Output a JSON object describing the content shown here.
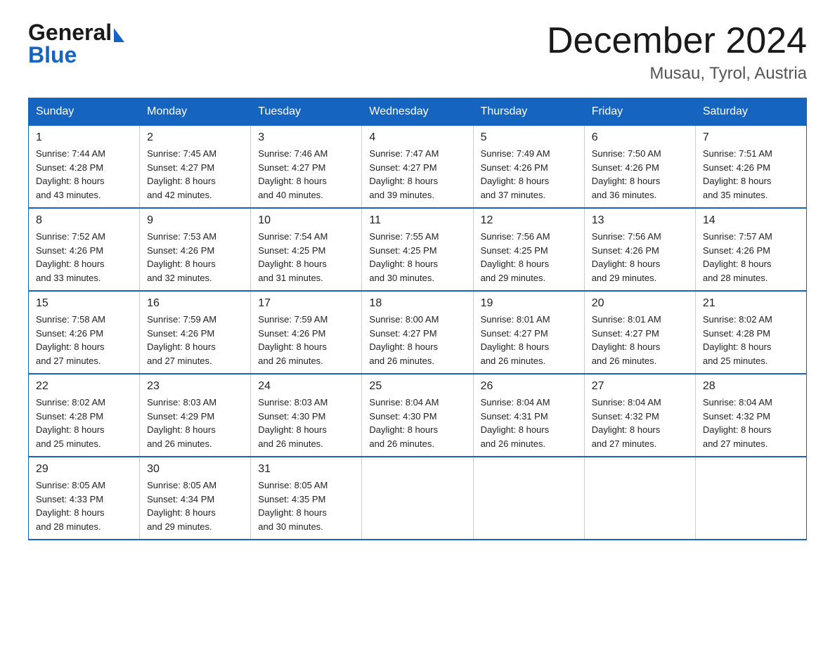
{
  "header": {
    "logo_general": "General",
    "logo_blue": "Blue",
    "month": "December 2024",
    "location": "Musau, Tyrol, Austria"
  },
  "weekdays": [
    "Sunday",
    "Monday",
    "Tuesday",
    "Wednesday",
    "Thursday",
    "Friday",
    "Saturday"
  ],
  "weeks": [
    [
      {
        "day": "1",
        "info": "Sunrise: 7:44 AM\nSunset: 4:28 PM\nDaylight: 8 hours\nand 43 minutes."
      },
      {
        "day": "2",
        "info": "Sunrise: 7:45 AM\nSunset: 4:27 PM\nDaylight: 8 hours\nand 42 minutes."
      },
      {
        "day": "3",
        "info": "Sunrise: 7:46 AM\nSunset: 4:27 PM\nDaylight: 8 hours\nand 40 minutes."
      },
      {
        "day": "4",
        "info": "Sunrise: 7:47 AM\nSunset: 4:27 PM\nDaylight: 8 hours\nand 39 minutes."
      },
      {
        "day": "5",
        "info": "Sunrise: 7:49 AM\nSunset: 4:26 PM\nDaylight: 8 hours\nand 37 minutes."
      },
      {
        "day": "6",
        "info": "Sunrise: 7:50 AM\nSunset: 4:26 PM\nDaylight: 8 hours\nand 36 minutes."
      },
      {
        "day": "7",
        "info": "Sunrise: 7:51 AM\nSunset: 4:26 PM\nDaylight: 8 hours\nand 35 minutes."
      }
    ],
    [
      {
        "day": "8",
        "info": "Sunrise: 7:52 AM\nSunset: 4:26 PM\nDaylight: 8 hours\nand 33 minutes."
      },
      {
        "day": "9",
        "info": "Sunrise: 7:53 AM\nSunset: 4:26 PM\nDaylight: 8 hours\nand 32 minutes."
      },
      {
        "day": "10",
        "info": "Sunrise: 7:54 AM\nSunset: 4:25 PM\nDaylight: 8 hours\nand 31 minutes."
      },
      {
        "day": "11",
        "info": "Sunrise: 7:55 AM\nSunset: 4:25 PM\nDaylight: 8 hours\nand 30 minutes."
      },
      {
        "day": "12",
        "info": "Sunrise: 7:56 AM\nSunset: 4:25 PM\nDaylight: 8 hours\nand 29 minutes."
      },
      {
        "day": "13",
        "info": "Sunrise: 7:56 AM\nSunset: 4:26 PM\nDaylight: 8 hours\nand 29 minutes."
      },
      {
        "day": "14",
        "info": "Sunrise: 7:57 AM\nSunset: 4:26 PM\nDaylight: 8 hours\nand 28 minutes."
      }
    ],
    [
      {
        "day": "15",
        "info": "Sunrise: 7:58 AM\nSunset: 4:26 PM\nDaylight: 8 hours\nand 27 minutes."
      },
      {
        "day": "16",
        "info": "Sunrise: 7:59 AM\nSunset: 4:26 PM\nDaylight: 8 hours\nand 27 minutes."
      },
      {
        "day": "17",
        "info": "Sunrise: 7:59 AM\nSunset: 4:26 PM\nDaylight: 8 hours\nand 26 minutes."
      },
      {
        "day": "18",
        "info": "Sunrise: 8:00 AM\nSunset: 4:27 PM\nDaylight: 8 hours\nand 26 minutes."
      },
      {
        "day": "19",
        "info": "Sunrise: 8:01 AM\nSunset: 4:27 PM\nDaylight: 8 hours\nand 26 minutes."
      },
      {
        "day": "20",
        "info": "Sunrise: 8:01 AM\nSunset: 4:27 PM\nDaylight: 8 hours\nand 26 minutes."
      },
      {
        "day": "21",
        "info": "Sunrise: 8:02 AM\nSunset: 4:28 PM\nDaylight: 8 hours\nand 25 minutes."
      }
    ],
    [
      {
        "day": "22",
        "info": "Sunrise: 8:02 AM\nSunset: 4:28 PM\nDaylight: 8 hours\nand 25 minutes."
      },
      {
        "day": "23",
        "info": "Sunrise: 8:03 AM\nSunset: 4:29 PM\nDaylight: 8 hours\nand 26 minutes."
      },
      {
        "day": "24",
        "info": "Sunrise: 8:03 AM\nSunset: 4:30 PM\nDaylight: 8 hours\nand 26 minutes."
      },
      {
        "day": "25",
        "info": "Sunrise: 8:04 AM\nSunset: 4:30 PM\nDaylight: 8 hours\nand 26 minutes."
      },
      {
        "day": "26",
        "info": "Sunrise: 8:04 AM\nSunset: 4:31 PM\nDaylight: 8 hours\nand 26 minutes."
      },
      {
        "day": "27",
        "info": "Sunrise: 8:04 AM\nSunset: 4:32 PM\nDaylight: 8 hours\nand 27 minutes."
      },
      {
        "day": "28",
        "info": "Sunrise: 8:04 AM\nSunset: 4:32 PM\nDaylight: 8 hours\nand 27 minutes."
      }
    ],
    [
      {
        "day": "29",
        "info": "Sunrise: 8:05 AM\nSunset: 4:33 PM\nDaylight: 8 hours\nand 28 minutes."
      },
      {
        "day": "30",
        "info": "Sunrise: 8:05 AM\nSunset: 4:34 PM\nDaylight: 8 hours\nand 29 minutes."
      },
      {
        "day": "31",
        "info": "Sunrise: 8:05 AM\nSunset: 4:35 PM\nDaylight: 8 hours\nand 30 minutes."
      },
      {
        "day": "",
        "info": ""
      },
      {
        "day": "",
        "info": ""
      },
      {
        "day": "",
        "info": ""
      },
      {
        "day": "",
        "info": ""
      }
    ]
  ]
}
